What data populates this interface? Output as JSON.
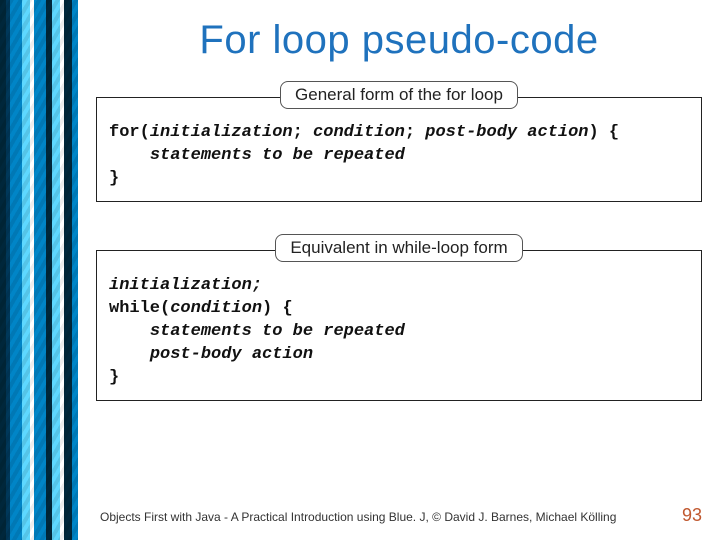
{
  "title": "For loop pseudo-code",
  "panel1": {
    "label": "General form of the for loop",
    "code_html": "<span class='kw'>for(</span><span class='it'>initialization</span><span class='kw'>;</span> <span class='it'>condition</span><span class='kw'>;</span> <span class='it'>post-body action</span><span class='kw'>) {</span>\n    <span class='it'>statements to be repeated</span>\n<span class='kw'>}</span>"
  },
  "panel2": {
    "label": "Equivalent in while-loop form",
    "code_html": "<span class='it'>initialization;</span>\n<span class='kw'>while(</span><span class='it'>condition</span><span class='kw'>) {</span>\n    <span class='it'>statements to be repeated</span>\n    <span class='it'>post-body action</span>\n<span class='kw'>}</span>"
  },
  "footer": {
    "text": "Objects First with Java - A Practical Introduction using Blue. J, © David J. Barnes, Michael Kölling",
    "page": "93"
  }
}
